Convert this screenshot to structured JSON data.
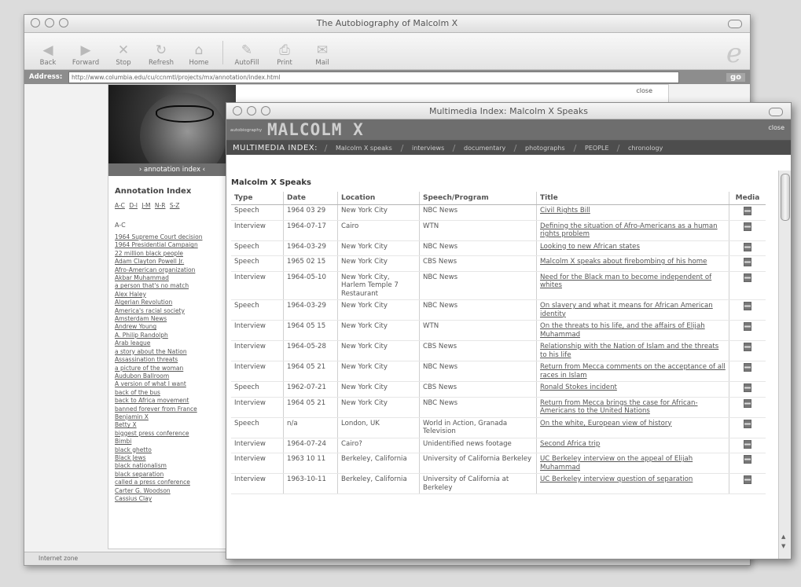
{
  "back_window": {
    "title": "The Autobiography of Malcolm X",
    "toolbar": [
      "Back",
      "Forward",
      "Stop",
      "Refresh",
      "Home",
      "AutoFill",
      "Print",
      "Mail"
    ],
    "address_label": "Address:",
    "address_value": "http://www.columbia.edu/cu/ccnmtl/projects/mx/annotation/index.html",
    "go_label": "go",
    "status_text": "Internet zone",
    "site_top_right": "close",
    "annotation_bar": "› annotation index ‹",
    "annotation_index": {
      "heading": "Annotation Index",
      "letter_links": [
        "A-C",
        "D-I",
        "J-M",
        "N-R",
        "S-Z"
      ],
      "section": "A-C",
      "entries": [
        "1964 Supreme Court decision",
        "1964 Presidential Campaign",
        "22 million black people",
        "Adam Clayton Powell Jr.",
        "Afro-American organization",
        "Akbar Muhammad",
        "a person that's no match",
        "Alex Haley",
        "Algerian Revolution",
        "America's racial society",
        "Amsterdam News",
        "Andrew Young",
        "A. Philip Randolph",
        "Arab league",
        "a story about the Nation",
        "Assassination threats",
        "a picture of the woman",
        "Audubon Ballroom",
        "A version of what I want",
        "back of the bus",
        "back to Africa movement",
        "banned forever from France",
        "Benjamin X",
        "Betty X",
        "biggest press conference",
        "Bimbi",
        "black ghetto",
        "Black Jews",
        "black nationalism",
        "black separation",
        "called a press conference",
        "Carter G. Woodson",
        "Cassius Clay"
      ]
    }
  },
  "front_window": {
    "title": "Multimedia Index: Malcolm X Speaks",
    "header_small": "autobiography",
    "logo": "MALCOLM X",
    "tools_text": "close",
    "nav_label": "MULTIMEDIA INDEX:",
    "nav_items": [
      "Malcolm X speaks",
      "interviews",
      "documentary",
      "photographs",
      "PEOPLE",
      "chronology"
    ],
    "section_title": "Malcolm X Speaks",
    "columns": [
      "Type",
      "Date",
      "Location",
      "Speech/Program",
      "Title",
      "Media"
    ],
    "rows": [
      {
        "type": "Speech",
        "date": "1964 03 29",
        "location": "New York City",
        "program": "NBC News",
        "title": "Civil Rights Bill",
        "group": true
      },
      {
        "type": "Interview",
        "date": "1964-07-17",
        "location": "Cairo",
        "program": "WTN",
        "title": "Defining the situation of Afro-Americans as a human rights problem",
        "group": false
      },
      {
        "type": "Speech",
        "date": "1964-03-29",
        "location": "New York City",
        "program": "NBC News",
        "title": "Looking to new African states",
        "group": false
      },
      {
        "type": "Speech",
        "date": "1965 02 15",
        "location": "New York City",
        "program": "CBS News",
        "title": "Malcolm X speaks about firebombing of his home",
        "group": true
      },
      {
        "type": "Interview",
        "date": "1964-05-10",
        "location": "New York City, Harlem Temple 7 Restaurant",
        "program": "NBC News",
        "title": "Need for the Black man to become independent of whites",
        "group": false
      },
      {
        "type": "Speech",
        "date": "1964-03-29",
        "location": "New York City",
        "program": "NBC News",
        "title": "On slavery and what it means for African American identity",
        "group": false
      },
      {
        "type": "Interview",
        "date": "1964 05 15",
        "location": "New York City",
        "program": "WTN",
        "title": "On the threats to his life, and the affairs of Elijah Muhammad",
        "group": true
      },
      {
        "type": "Interview",
        "date": "1964-05-28",
        "location": "New York City",
        "program": "CBS News",
        "title": "Relationship with the Nation of Islam and the threats to his life",
        "group": false
      },
      {
        "type": "Interview",
        "date": "1964 05 21",
        "location": "New York City",
        "program": "NBC News",
        "title": "Return from Mecca comments on the acceptance of all races in Islam",
        "group": true
      },
      {
        "type": "Speech",
        "date": "1962-07-21",
        "location": "New York City",
        "program": "CBS News",
        "title": "Ronald Stokes incident",
        "group": false
      },
      {
        "type": "Interview",
        "date": "1964 05 21",
        "location": "New York City",
        "program": "NBC News",
        "title": "Return from Mecca brings the case for African-Americans to the United Nations",
        "group": true
      },
      {
        "type": "Speech",
        "date": "n/a",
        "location": "London, UK",
        "program": "World in Action, Granada Television",
        "title": "On the white, European view of history",
        "group": true
      },
      {
        "type": "Interview",
        "date": "1964-07-24",
        "location": "Cairo?",
        "program": "Unidentified news footage",
        "title": "Second Africa trip",
        "group": false
      },
      {
        "type": "Interview",
        "date": "1963 10 11",
        "location": "Berkeley, California",
        "program": "University of California Berkeley",
        "title": "UC Berkeley interview on the appeal of Elijah Muhammad",
        "group": true
      },
      {
        "type": "Interview",
        "date": "1963-10-11",
        "location": "Berkeley, California",
        "program": "University of California at Berkeley",
        "title": "UC Berkeley interview question of separation",
        "group": false
      }
    ]
  }
}
